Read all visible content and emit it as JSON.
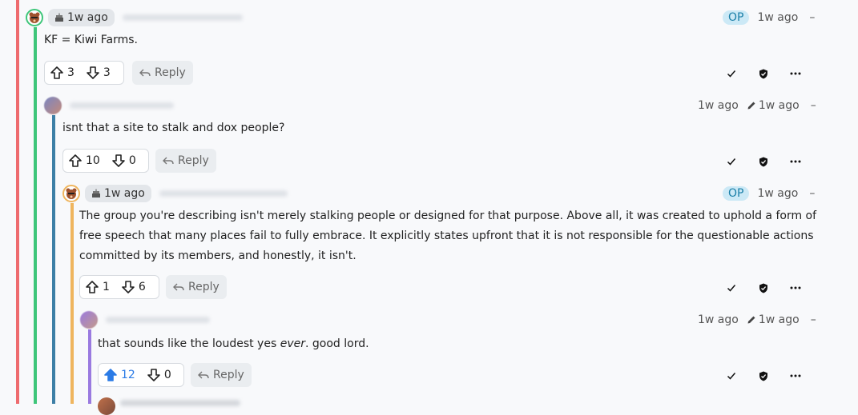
{
  "colors": {
    "thread1": "#ee6b6e",
    "thread2": "#3ec67a",
    "thread3": "#3d7fa6",
    "thread4": "#efb55e",
    "thread5": "#9a7ae0",
    "op_bg": "#cce9f6",
    "upvote_active": "#2b7be6"
  },
  "comments": [
    {
      "author_icon": "cake-icon",
      "age_badge": "1w ago",
      "op": "OP",
      "time": "1w ago",
      "collapse": "–",
      "text": "KF = Kiwi Farms.",
      "upvotes": "3",
      "downvotes": "3",
      "reply": "Reply"
    },
    {
      "time": "1w ago",
      "edited_time": "1w ago",
      "collapse": "–",
      "text": "isnt that a site to stalk and dox people?",
      "upvotes": "10",
      "downvotes": "0",
      "reply": "Reply"
    },
    {
      "author_icon": "cake-icon",
      "age_badge": "1w ago",
      "op": "OP",
      "time": "1w ago",
      "collapse": "–",
      "text_lines": [
        "The group you're describing isn't merely stalking people or designed for that purpose. Above all, it was created to uphold a form of",
        "free speech that many places fail to fully embrace. It explicitly states upfront that it is not responsible for the questionable actions",
        "committed by its members, and honestly, it isn't."
      ],
      "upvotes": "1",
      "downvotes": "6",
      "reply": "Reply"
    },
    {
      "time": "1w ago",
      "edited_time": "1w ago",
      "collapse": "–",
      "text_before": "that sounds like the loudest yes ",
      "text_em": "ever",
      "text_after": ". good lord.",
      "upvotes": "12",
      "downvotes": "0",
      "reply": "Reply"
    }
  ]
}
